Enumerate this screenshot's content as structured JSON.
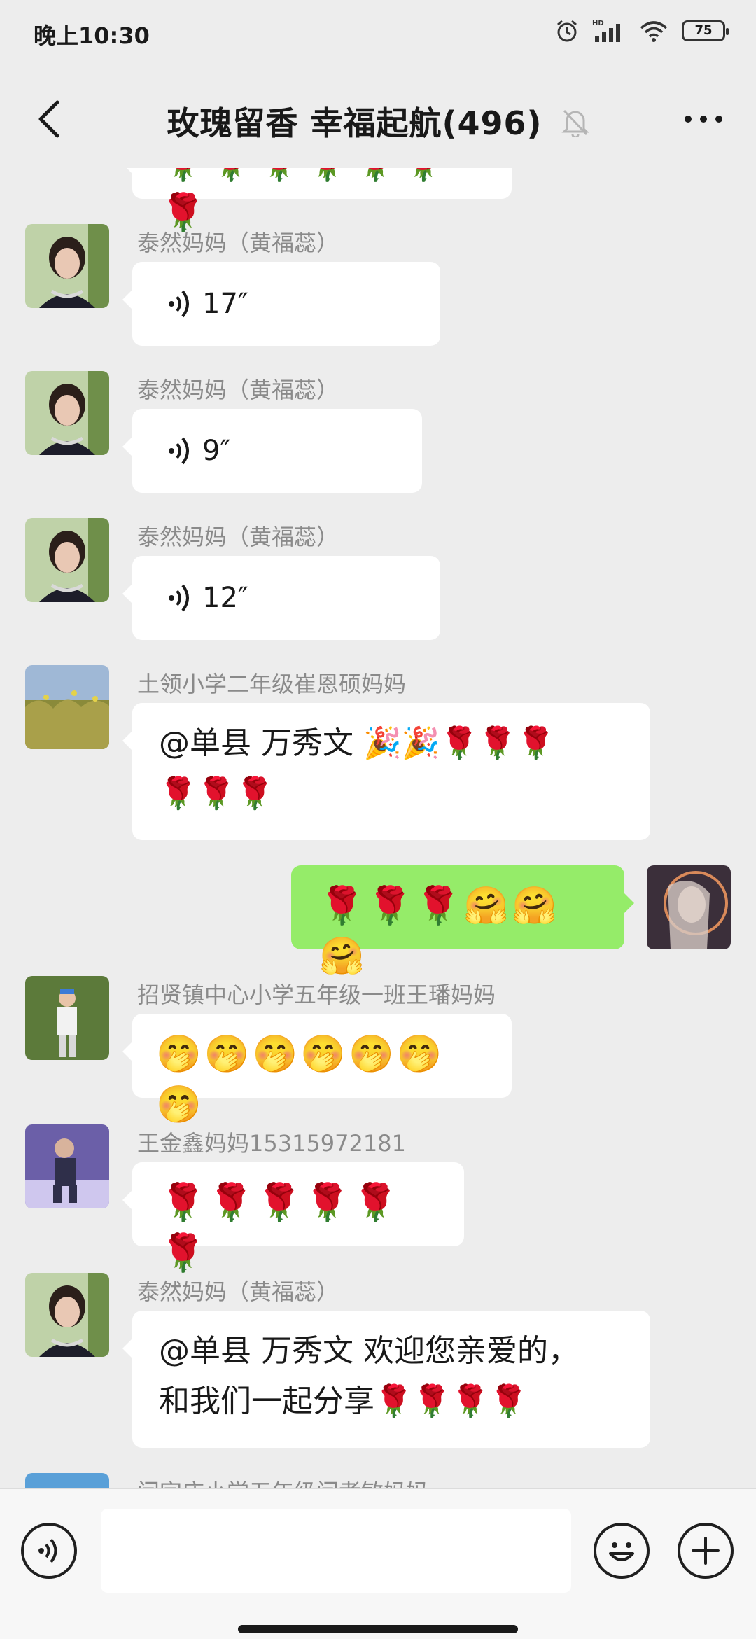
{
  "status_bar": {
    "time": "晚上10:30",
    "battery": "75",
    "icons": [
      "alarm-icon",
      "hd-signal-icon",
      "wifi-icon",
      "battery-icon"
    ]
  },
  "header": {
    "title": "玫瑰留香  幸福起航(496)",
    "back_icon": "chevron-left-icon",
    "mute_icon": "bell-off-icon",
    "more_icon": "more-dots-icon"
  },
  "messages": [
    {
      "type": "emoji",
      "direction": "in",
      "text": "🌹🌹🌹🌹🌹🌹🌹"
    },
    {
      "type": "voice",
      "direction": "in",
      "sender": "泰然妈妈（黄福蕊）",
      "duration": "17″"
    },
    {
      "type": "voice",
      "direction": "in",
      "sender": "泰然妈妈（黄福蕊）",
      "duration": "9″"
    },
    {
      "type": "voice",
      "direction": "in",
      "sender": "泰然妈妈（黄福蕊）",
      "duration": "12″"
    },
    {
      "type": "text",
      "direction": "in",
      "sender": "土领小学二年级崔恩硕妈妈",
      "line1": "@单县 万秀文 🎉🎉🌹🌹🌹",
      "line2": "🌹🌹🌹"
    },
    {
      "type": "emoji",
      "direction": "out",
      "text": "🌹🌹🌹🤗🤗🤗"
    },
    {
      "type": "emoji",
      "direction": "in",
      "sender": "招贤镇中心小学五年级一班王璠妈妈",
      "text": "🤭🤭🤭🤭🤭🤭🤭"
    },
    {
      "type": "emoji",
      "direction": "in",
      "sender": "王金鑫妈妈15315972181",
      "text": "🌹🌹🌹🌹🌹🌹"
    },
    {
      "type": "text",
      "direction": "in",
      "sender": "泰然妈妈（黄福蕊）",
      "line1": "@单县 万秀文  欢迎您亲爱的，",
      "line2": "和我们一起分享🌹🌹🌹🌹"
    },
    {
      "type": "partial",
      "direction": "in",
      "sender": "闫字庄小学五年级闫孝敏妈妈"
    }
  ],
  "input_bar": {
    "voice_icon": "voice-input-icon",
    "placeholder": "",
    "emoji_icon": "emoji-icon",
    "plus_icon": "plus-icon"
  }
}
